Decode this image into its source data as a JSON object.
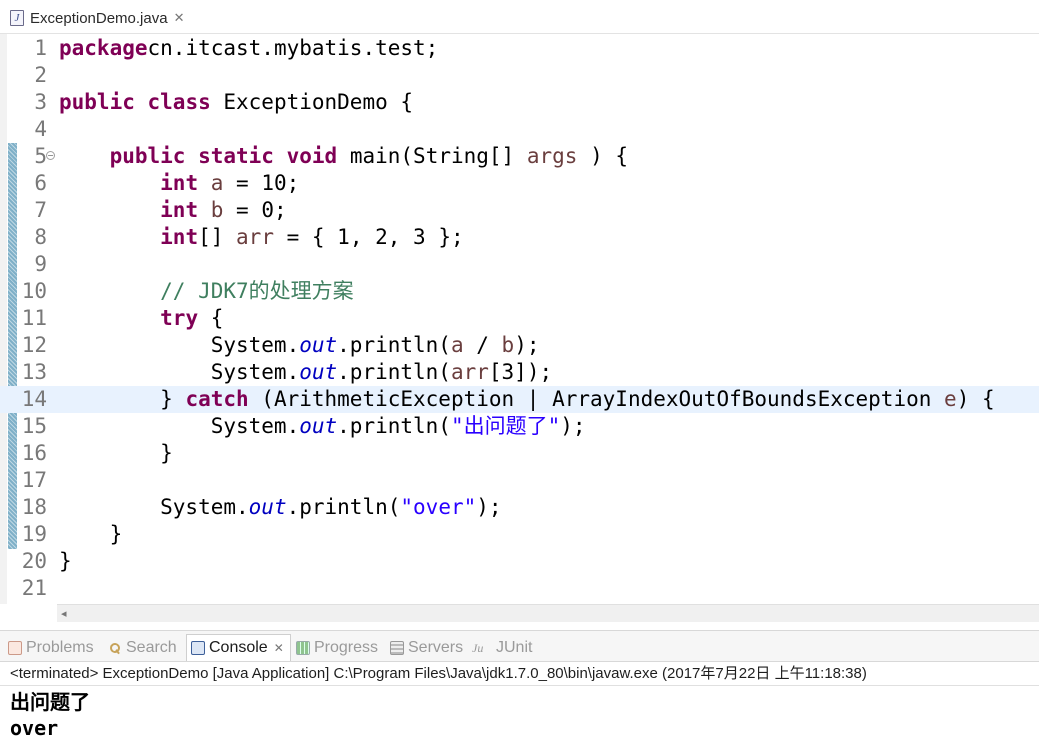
{
  "editor_tab": {
    "filename": "ExceptionDemo.java",
    "close_glyph": "✕",
    "icon": "java-file-icon"
  },
  "editor": {
    "current_line": 14,
    "changed_lines": "5-19",
    "lines": [
      {
        "n": "1",
        "tokens": [
          [
            "kw",
            "package"
          ],
          [
            "",
            "cn.itcast.mybatis.test;"
          ]
        ]
      },
      {
        "n": "2",
        "tokens": []
      },
      {
        "n": "3",
        "tokens": [
          [
            "kw",
            "public"
          ],
          [
            "",
            " "
          ],
          [
            "kw",
            "class"
          ],
          [
            "",
            " ExceptionDemo {"
          ]
        ]
      },
      {
        "n": "4",
        "tokens": []
      },
      {
        "n": "5",
        "fold": "⊖",
        "tokens": [
          [
            "",
            "    "
          ],
          [
            "kw",
            "public"
          ],
          [
            "",
            " "
          ],
          [
            "kw",
            "static"
          ],
          [
            "",
            " "
          ],
          [
            "kw",
            "void"
          ],
          [
            "",
            " main(String[] "
          ],
          [
            "var",
            "args"
          ],
          [
            "",
            " ) {"
          ]
        ]
      },
      {
        "n": "6",
        "tokens": [
          [
            "",
            "        "
          ],
          [
            "kw",
            "int"
          ],
          [
            "",
            " "
          ],
          [
            "var",
            "a"
          ],
          [
            "",
            " = 10;"
          ]
        ]
      },
      {
        "n": "7",
        "tokens": [
          [
            "",
            "        "
          ],
          [
            "kw",
            "int"
          ],
          [
            "",
            " "
          ],
          [
            "var",
            "b"
          ],
          [
            "",
            " = 0;"
          ]
        ]
      },
      {
        "n": "8",
        "tokens": [
          [
            "",
            "        "
          ],
          [
            "kw",
            "int"
          ],
          [
            "",
            "[] "
          ],
          [
            "var",
            "arr"
          ],
          [
            "",
            " = { 1, 2, 3 };"
          ]
        ]
      },
      {
        "n": "9",
        "tokens": []
      },
      {
        "n": "10",
        "tokens": [
          [
            "",
            "        "
          ],
          [
            "cmt",
            "// JDK7的处理方案"
          ]
        ]
      },
      {
        "n": "11",
        "tokens": [
          [
            "",
            "        "
          ],
          [
            "kw",
            "try"
          ],
          [
            "",
            " {"
          ]
        ]
      },
      {
        "n": "12",
        "tokens": [
          [
            "",
            "            System."
          ],
          [
            "field",
            "out"
          ],
          [
            "",
            ".println("
          ],
          [
            "var",
            "a"
          ],
          [
            "",
            " / "
          ],
          [
            "var",
            "b"
          ],
          [
            "",
            ");"
          ]
        ]
      },
      {
        "n": "13",
        "tokens": [
          [
            "",
            "            System."
          ],
          [
            "field",
            "out"
          ],
          [
            "",
            ".println("
          ],
          [
            "var",
            "arr"
          ],
          [
            "",
            "[3]);"
          ]
        ]
      },
      {
        "n": "14",
        "tokens": [
          [
            "",
            "        } "
          ],
          [
            "kw",
            "catch"
          ],
          [
            "",
            " (ArithmeticException | ArrayIndexOutOfBoundsException "
          ],
          [
            "var",
            "e"
          ],
          [
            "",
            ") {"
          ]
        ]
      },
      {
        "n": "15",
        "tokens": [
          [
            "",
            "            System."
          ],
          [
            "field",
            "out"
          ],
          [
            "",
            ".println("
          ],
          [
            "str",
            "\"出问题了\""
          ],
          [
            "",
            ");"
          ]
        ]
      },
      {
        "n": "16",
        "tokens": [
          [
            "",
            "        }"
          ]
        ]
      },
      {
        "n": "17",
        "tokens": []
      },
      {
        "n": "18",
        "tokens": [
          [
            "",
            "        System."
          ],
          [
            "field",
            "out"
          ],
          [
            "",
            ".println("
          ],
          [
            "str",
            "\"over\""
          ],
          [
            "",
            ");"
          ]
        ]
      },
      {
        "n": "19",
        "tokens": [
          [
            "",
            "    }"
          ]
        ]
      },
      {
        "n": "20",
        "tokens": [
          [
            "",
            "}"
          ]
        ]
      },
      {
        "n": "21",
        "tokens": []
      }
    ]
  },
  "scrollbar": {
    "left_arrow": "◂"
  },
  "views": {
    "tabs": [
      {
        "id": "problems",
        "label": "Problems",
        "icon": "problems-icon",
        "active": false
      },
      {
        "id": "search",
        "label": "Search",
        "icon": "search-icon",
        "active": false
      },
      {
        "id": "console",
        "label": "Console",
        "icon": "console-icon",
        "active": true,
        "close_glyph": "✕"
      },
      {
        "id": "progress",
        "label": "Progress",
        "icon": "progress-icon",
        "active": false
      },
      {
        "id": "servers",
        "label": "Servers",
        "icon": "servers-icon",
        "active": false
      },
      {
        "id": "junit",
        "label": "JUnit",
        "icon": "junit-icon",
        "icon_text": "Ju",
        "active": false
      }
    ]
  },
  "console": {
    "header": "<terminated> ExceptionDemo [Java Application] C:\\Program Files\\Java\\jdk1.7.0_80\\bin\\javaw.exe (2017年7月22日 上午11:18:38)",
    "output": [
      "出问题了",
      "over"
    ]
  }
}
